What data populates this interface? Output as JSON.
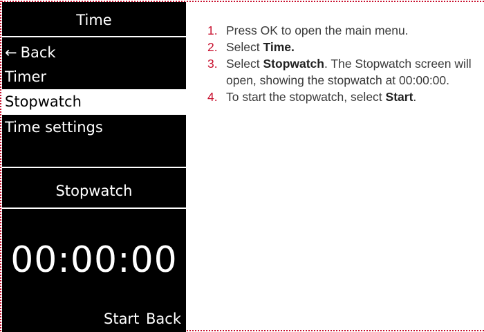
{
  "menu_screen": {
    "title": "Time",
    "items": [
      {
        "label": "Back",
        "icon": "arrow-left-icon",
        "selected": false
      },
      {
        "label": "Timer",
        "selected": false
      },
      {
        "label": "Stopwatch",
        "selected": true
      },
      {
        "label": "Time settings",
        "selected": false
      }
    ]
  },
  "stopwatch_screen": {
    "title": "Stopwatch",
    "time": "00:00:00",
    "softkeys": {
      "start": "Start",
      "back": "Back"
    }
  },
  "instructions": [
    {
      "number": "1.",
      "parts": [
        {
          "text": "Press OK to open the main menu."
        }
      ]
    },
    {
      "number": "2.",
      "parts": [
        {
          "text": "Select "
        },
        {
          "text": "Time.",
          "bold": true
        }
      ]
    },
    {
      "number": "3.",
      "parts": [
        {
          "text": "Select "
        },
        {
          "text": "Stopwatch",
          "bold": true
        },
        {
          "text": ". The Stopwatch screen will open, showing the stopwatch at 00:00:00."
        }
      ]
    },
    {
      "number": "4.",
      "parts": [
        {
          "text": "To start the stopwatch, select "
        },
        {
          "text": "Start",
          "bold": true
        },
        {
          "text": "."
        }
      ]
    }
  ],
  "colors": {
    "accent": "#c8102e",
    "screen_background": "#000000",
    "screen_text": "#ffffff",
    "body_text": "#3a3a3a"
  }
}
